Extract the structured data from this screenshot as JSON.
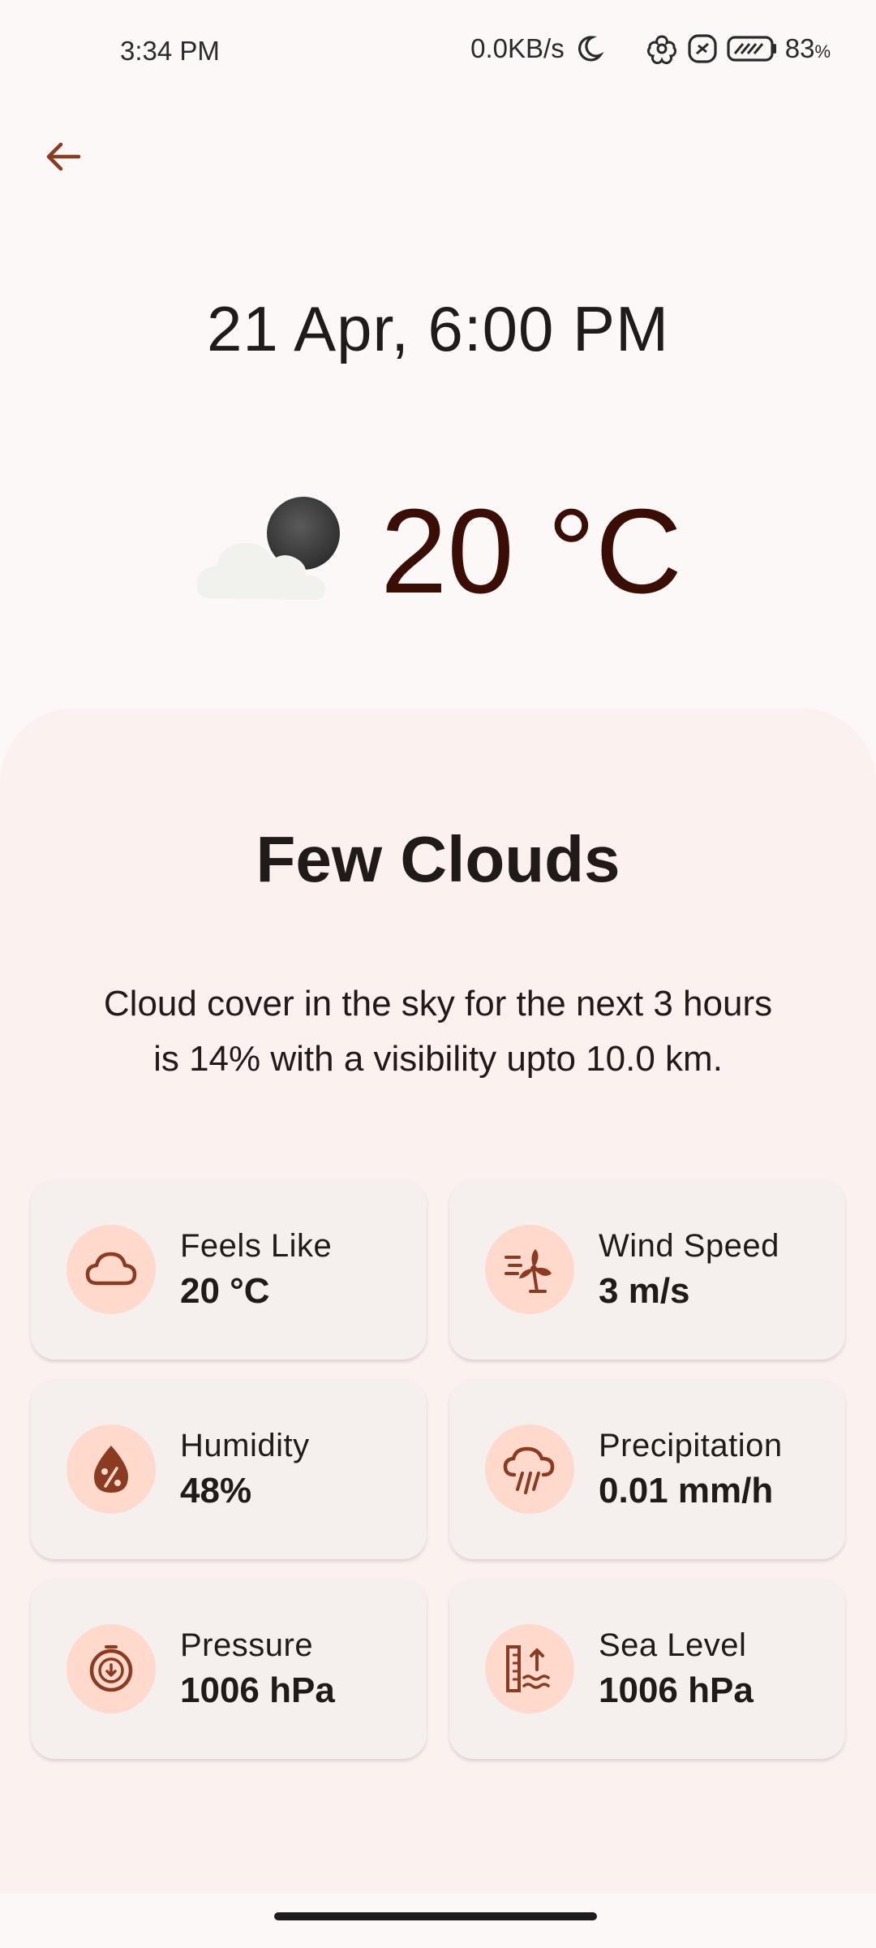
{
  "status_bar": {
    "time": "3:34 PM",
    "network_speed": "0.0KB/s",
    "battery": "83",
    "battery_unit": "%"
  },
  "header": {
    "date_time": "21 Apr, 6:00 PM",
    "temperature": "20 °C",
    "weather_icon": "cloud-night-icon"
  },
  "condition": {
    "title": "Few Clouds",
    "description": "Cloud cover in the sky for the next 3 hours is 14% with a visibility upto 10.0 km."
  },
  "details": [
    {
      "label": "Feels Like",
      "value": "20 °C",
      "icon": "cloud-icon"
    },
    {
      "label": "Wind Speed",
      "value": "3 m/s",
      "icon": "wind-turbine-icon"
    },
    {
      "label": "Humidity",
      "value": "48%",
      "icon": "humidity-drop-icon"
    },
    {
      "label": "Precipitation",
      "value": "0.01 mm/h",
      "icon": "rain-cloud-icon"
    },
    {
      "label": "Pressure",
      "value": "1006 hPa",
      "icon": "pressure-gauge-icon"
    },
    {
      "label": "Sea Level",
      "value": "1006 hPa",
      "icon": "sea-level-icon"
    }
  ],
  "colors": {
    "background": "#fdf8f8",
    "sheet": "#fbf1ef",
    "card": "#f5efee",
    "icon_bg": "#ffd9cc",
    "icon_fg": "#8a3b22",
    "temperature_text": "#3a0d05"
  }
}
